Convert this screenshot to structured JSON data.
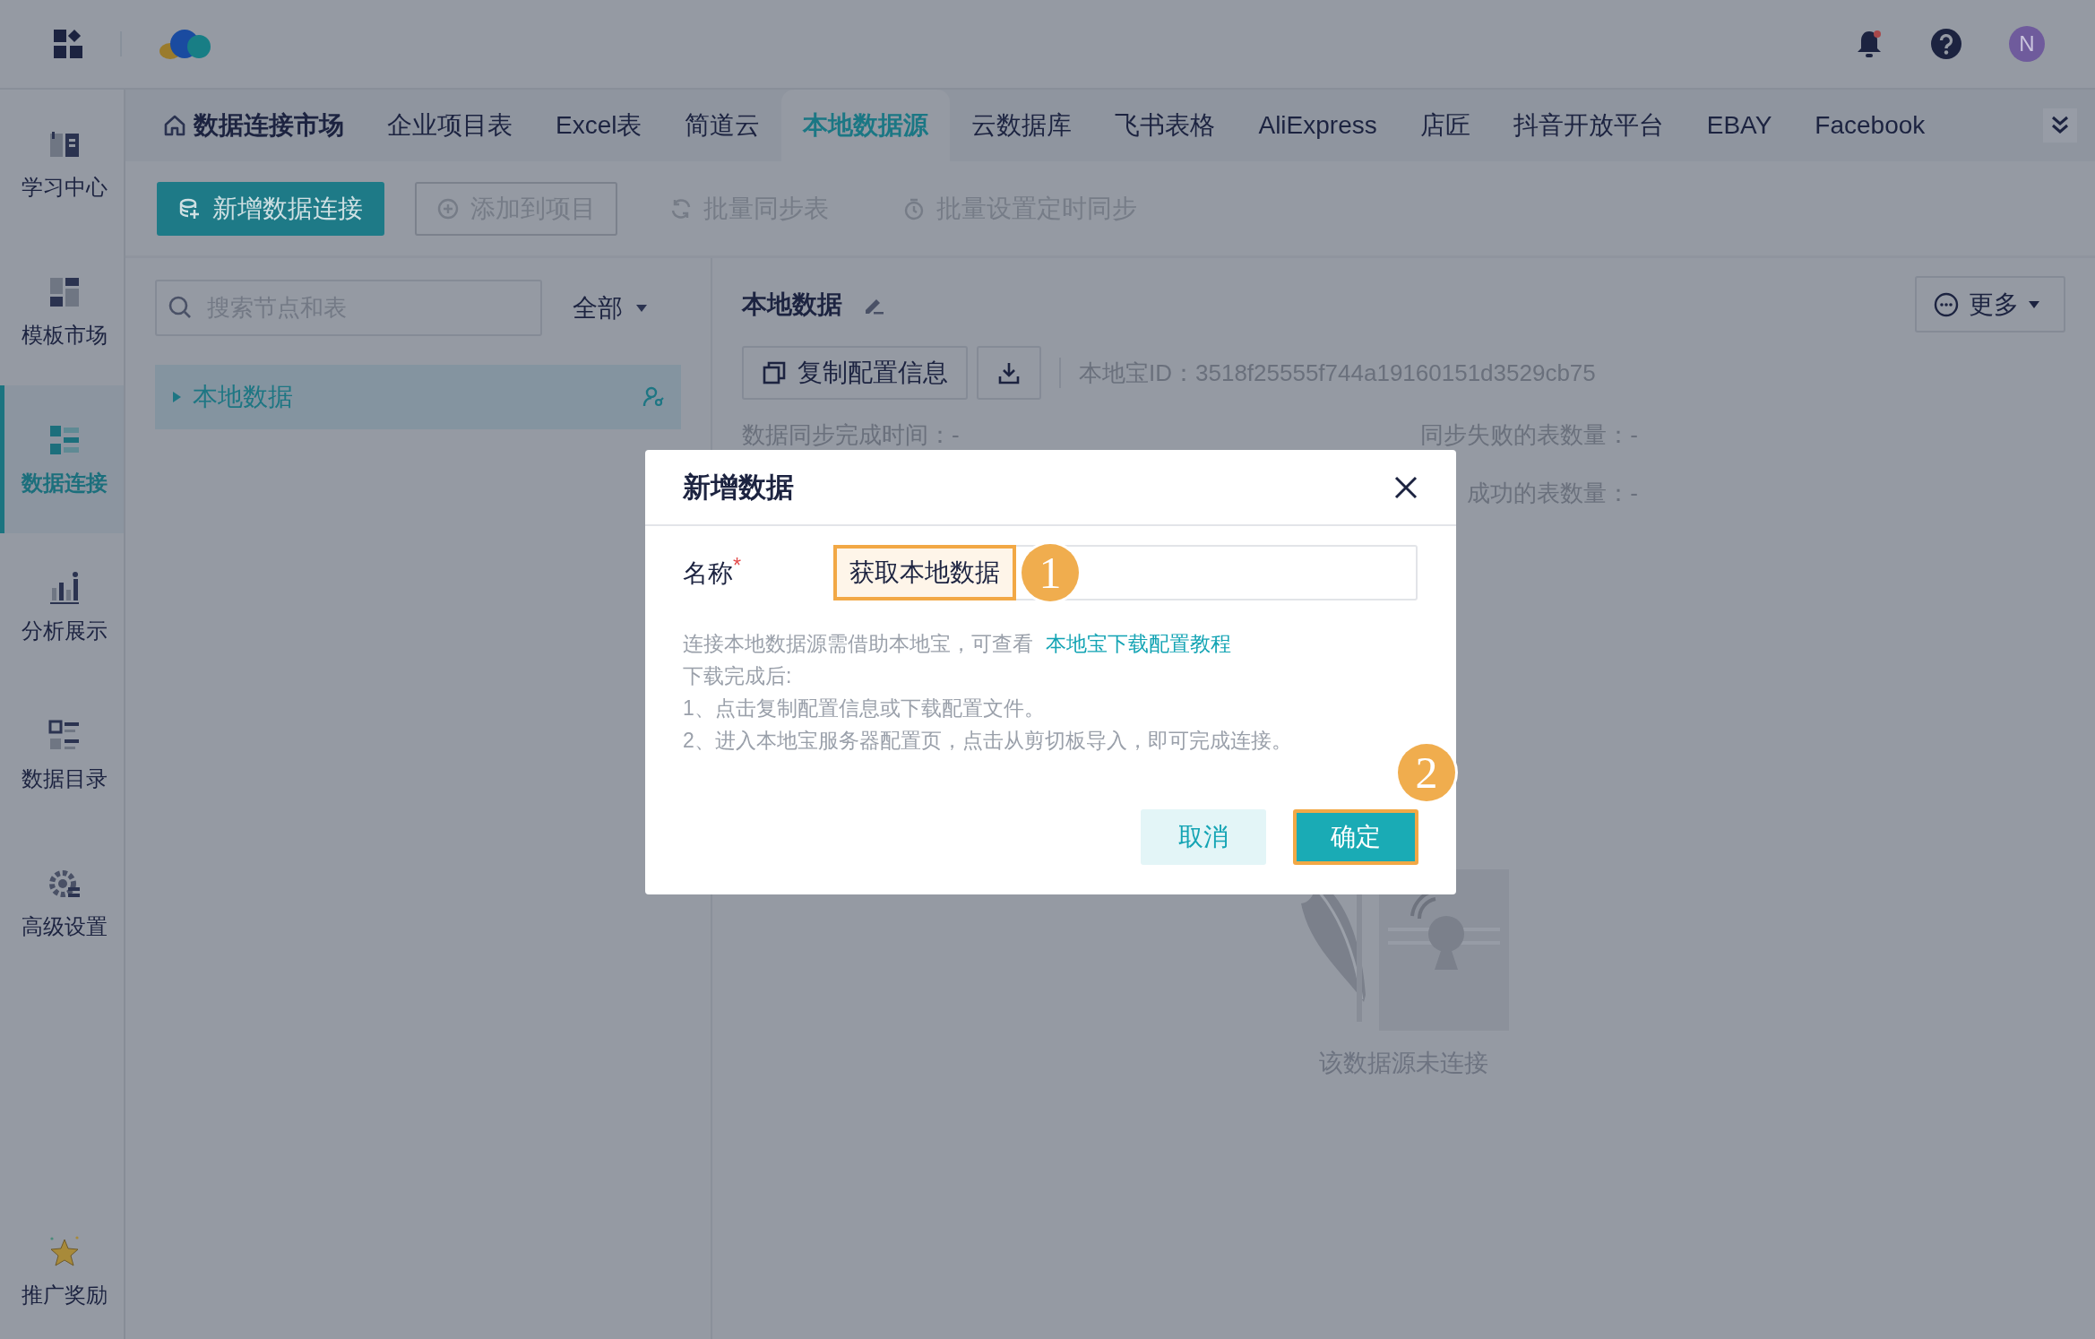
{
  "header": {
    "avatar": "N"
  },
  "sidebar": {
    "items": [
      {
        "label": "学习中心",
        "kind": "book",
        "selected": false
      },
      {
        "label": "模板市场",
        "kind": "template",
        "selected": false
      },
      {
        "label": "数据连接",
        "kind": "connect",
        "selected": true
      },
      {
        "label": "分析展示",
        "kind": "chart",
        "selected": false
      },
      {
        "label": "数据目录",
        "kind": "catalog",
        "selected": false
      },
      {
        "label": "高级设置",
        "kind": "settings",
        "selected": false
      }
    ],
    "footer_item": {
      "label": "推广奖励"
    }
  },
  "tabs": [
    {
      "label": "数据连接市场",
      "kind": "home",
      "selected": false
    },
    {
      "label": "企业项目表",
      "kind": "plain",
      "selected": false
    },
    {
      "label": "Excel表",
      "kind": "plain",
      "selected": false
    },
    {
      "label": "简道云",
      "kind": "plain",
      "selected": false
    },
    {
      "label": "本地数据源",
      "kind": "plain",
      "selected": true
    },
    {
      "label": "云数据库",
      "kind": "plain",
      "selected": false
    },
    {
      "label": "飞书表格",
      "kind": "plain",
      "selected": false
    },
    {
      "label": "AliExpress",
      "kind": "plain",
      "selected": false
    },
    {
      "label": "店匠",
      "kind": "plain",
      "selected": false
    },
    {
      "label": "抖音开放平台",
      "kind": "plain",
      "selected": false
    },
    {
      "label": "EBAY",
      "kind": "plain",
      "selected": false
    },
    {
      "label": "Facebook",
      "kind": "plain",
      "selected": false
    }
  ],
  "toolbar": {
    "buttons": [
      {
        "label": "新增数据连接",
        "kind": "primary",
        "disabled": false
      },
      {
        "label": "添加到项目",
        "kind": "outline",
        "disabled": true
      },
      {
        "label": "批量同步表",
        "kind": "text",
        "disabled": true
      },
      {
        "label": "批量设置定时同步",
        "kind": "text",
        "disabled": true
      }
    ]
  },
  "left_panel": {
    "search": {
      "placeholder": "搜索节点和表"
    },
    "filter": "全部",
    "tree": [
      {
        "label": "本地数据",
        "selected": true,
        "expanded": false
      }
    ]
  },
  "detail": {
    "title": "本地数据",
    "more": "更多",
    "copy_button": "复制配置信息",
    "id_text": "本地宝ID：3518f25555f744a19160151d3529cb75",
    "stats": [
      {
        "text": "数据同步完成时间：-"
      },
      {
        "text": "同步失败的表数量：-"
      },
      {
        "text": "成功的表数量：-"
      }
    ],
    "empty_text": "该数据源未连接"
  },
  "dialog": {
    "title": "新增数据",
    "field": {
      "label": "名称",
      "required_mark": "*",
      "value": "获取本地数据"
    },
    "help": {
      "intro": "连接本地数据源需借助本地宝，可查看",
      "link": "本地宝下载配置教程",
      "lines": [
        "下载完成后:",
        "1、点击复制配置信息或下载配置文件。",
        "2、进入本地宝服务器配置页，点击从剪切板导入，即可完成连接。"
      ]
    },
    "buttons": [
      {
        "label": "取消",
        "kind": "secondary"
      },
      {
        "label": "确定",
        "kind": "primary"
      }
    ],
    "step_marks": [
      "1",
      "2"
    ]
  }
}
